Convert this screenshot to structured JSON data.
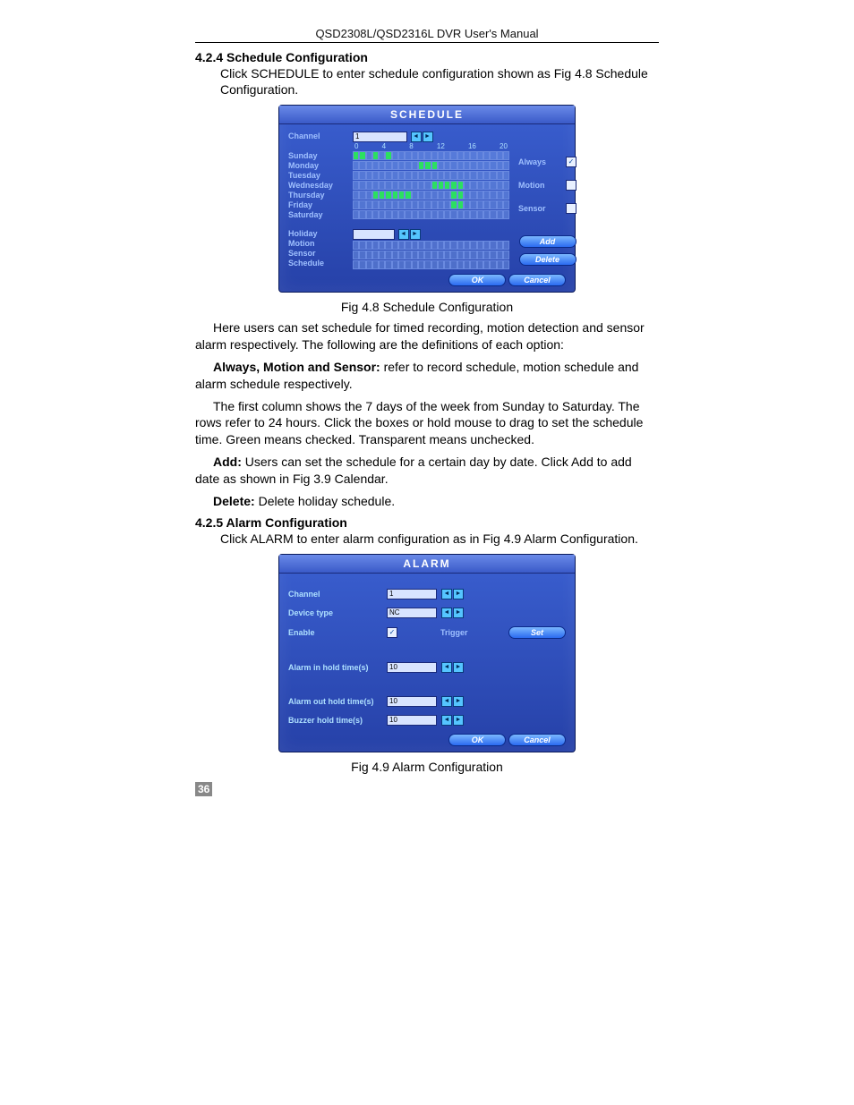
{
  "header": "QSD2308L/QSD2316L DVR User's Manual",
  "page_number": "36",
  "sec1": {
    "num": "4.2.4",
    "title": "Schedule Configuration",
    "intro": "Click SCHEDULE to enter schedule configuration shown as Fig 4.8 Schedule Configuration.",
    "fig": "Fig 4.8 Schedule Configuration",
    "p1": "Here users can set schedule for timed recording, motion detection and sensor alarm respectively. The following are the definitions of each option:",
    "p2b": "Always, Motion and Sensor:",
    "p2": " refer to record schedule, motion schedule and alarm schedule respectively.",
    "p3": "The first column shows the 7 days of the week from Sunday to Saturday. The rows refer to 24 hours. Click the boxes or hold mouse to drag to set the schedule time. Green means checked. Transparent means unchecked.",
    "p4b": "Add:",
    "p4": " Users can set the schedule for a certain day by date. Click Add to add date as shown in Fig 3.9 Calendar.",
    "p5b": "Delete:",
    "p5": " Delete holiday schedule."
  },
  "sec2": {
    "num": "4.2.5",
    "title": "Alarm Configuration",
    "intro": "Click ALARM to enter alarm configuration as in Fig 4.9 Alarm Configuration.",
    "fig": "Fig 4.9 Alarm Configuration"
  },
  "sched": {
    "title": "SCHEDULE",
    "channel_label": "Channel",
    "channel_value": "1",
    "hours": [
      "0",
      "4",
      "8",
      "12",
      "16",
      "20"
    ],
    "days": [
      "Sunday",
      "Monday",
      "Tuesday",
      "Wednesday",
      "Thursday",
      "Friday",
      "Saturday"
    ],
    "holiday": "Holiday",
    "motion": "Motion",
    "sensor": "Sensor",
    "schedule": "Schedule",
    "opt_always": "Always",
    "opt_motion": "Motion",
    "opt_sensor": "Sensor",
    "add": "Add",
    "delete": "Delete",
    "ok": "OK",
    "cancel": "Cancel"
  },
  "alarm": {
    "title": "ALARM",
    "channel": "Channel",
    "channel_v": "1",
    "devtype": "Device type",
    "devtype_v": "NC",
    "enable": "Enable",
    "trigger": "Trigger",
    "set": "Set",
    "ain": "Alarm in hold time(s)",
    "ain_v": "10",
    "aout": "Alarm out hold time(s)",
    "aout_v": "10",
    "buz": "Buzzer hold time(s)",
    "buz_v": "10",
    "ok": "OK",
    "cancel": "Cancel"
  }
}
